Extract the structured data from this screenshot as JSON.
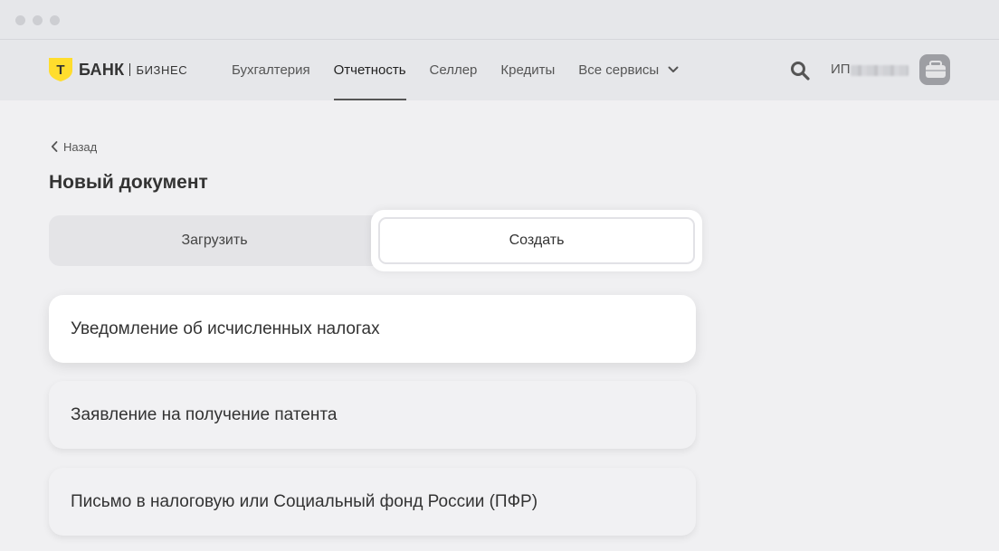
{
  "window": {
    "controls": [
      "close",
      "minimize",
      "maximize"
    ]
  },
  "header": {
    "logo": {
      "letter": "Т",
      "brand": "БАНК",
      "sub": "БИЗНЕС",
      "accent_color": "#ffdd2d"
    },
    "nav": [
      {
        "label": "Бухгалтерия",
        "active": false
      },
      {
        "label": "Отчетность",
        "active": true
      },
      {
        "label": "Селлер",
        "active": false
      },
      {
        "label": "Кредиты",
        "active": false
      },
      {
        "label": "Все сервисы",
        "active": false,
        "has_dropdown": true
      }
    ],
    "search_icon": "search-icon",
    "account_label": "ИП",
    "avatar_icon": "briefcase-icon"
  },
  "back": {
    "label": "Назад"
  },
  "page_title": "Новый документ",
  "segmented": {
    "upload_label": "Загрузить",
    "create_label": "Создать",
    "selected": "create"
  },
  "documents": [
    "Уведомление об исчисленных налогах",
    "Заявление на получение патента",
    "Письмо в налоговую или Социальный фонд России (ПФР)"
  ]
}
